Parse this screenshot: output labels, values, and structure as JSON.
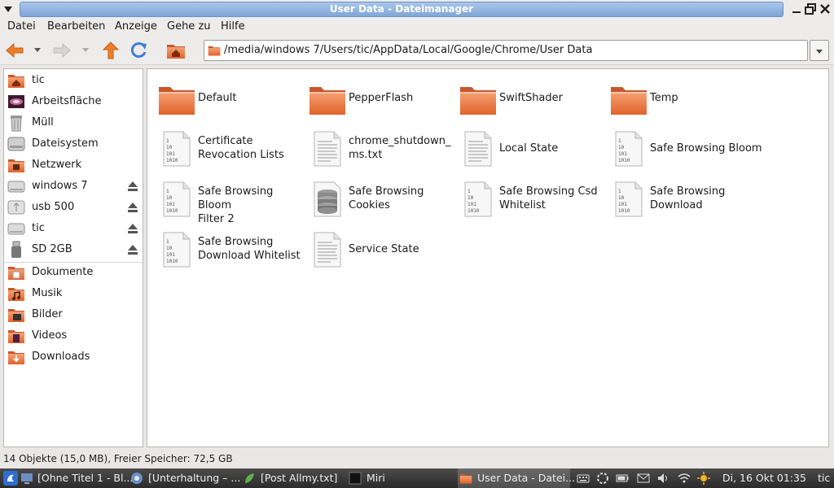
{
  "window": {
    "title": "User Data - Dateimanager"
  },
  "menu": [
    "Datei",
    "Bearbeiten",
    "Anzeige",
    "Gehe zu",
    "Hilfe"
  ],
  "address": {
    "path": "/media/windows 7/Users/tic/AppData/Local/Google/Chrome/User Data"
  },
  "sidebar": {
    "places": [
      {
        "label": "tic",
        "icon": "home-icon"
      },
      {
        "label": "Arbeitsfläche",
        "icon": "desktop-icon"
      },
      {
        "label": "Müll",
        "icon": "trash-icon"
      },
      {
        "label": "Dateisystem",
        "icon": "harddisk-icon"
      },
      {
        "label": "Netzwerk",
        "icon": "network-icon"
      }
    ],
    "devices": [
      {
        "label": "windows 7",
        "icon": "drive-icon"
      },
      {
        "label": "usb 500",
        "icon": "usb-drive-icon"
      },
      {
        "label": "tic",
        "icon": "drive-icon"
      },
      {
        "label": "SD 2GB",
        "icon": "usb-stick-icon"
      }
    ],
    "bookmarks": [
      {
        "label": "Dokumente",
        "icon": "documents-folder-icon"
      },
      {
        "label": "Musik",
        "icon": "music-folder-icon"
      },
      {
        "label": "Bilder",
        "icon": "pictures-folder-icon"
      },
      {
        "label": "Videos",
        "icon": "videos-folder-icon"
      },
      {
        "label": "Downloads",
        "icon": "downloads-folder-icon"
      }
    ]
  },
  "files": [
    {
      "line1": "Default",
      "line2": "",
      "type": "folder"
    },
    {
      "line1": "PepperFlash",
      "line2": "",
      "type": "folder"
    },
    {
      "line1": "SwiftShader",
      "line2": "",
      "type": "folder"
    },
    {
      "line1": "Temp",
      "line2": "",
      "type": "folder"
    },
    {
      "line1": "Certificate",
      "line2": "Revocation Lists",
      "type": "binary"
    },
    {
      "line1": "chrome_shutdown_",
      "line2": "ms.txt",
      "type": "text"
    },
    {
      "line1": "Local State",
      "line2": "",
      "type": "text"
    },
    {
      "line1": "Safe Browsing Bloom",
      "line2": "",
      "type": "binary"
    },
    {
      "line1": "Safe Browsing Bloom",
      "line2": "Filter 2",
      "type": "binary"
    },
    {
      "line1": "Safe Browsing",
      "line2": "Cookies",
      "type": "database"
    },
    {
      "line1": "Safe Browsing Csd",
      "line2": "Whitelist",
      "type": "binary"
    },
    {
      "line1": "Safe Browsing",
      "line2": "Download",
      "type": "binary"
    },
    {
      "line1": "Safe Browsing",
      "line2": "Download Whitelist",
      "type": "binary"
    },
    {
      "line1": "Service State",
      "line2": "",
      "type": "text"
    }
  ],
  "status": "14 Objekte (15,0 MB), Freier Speicher: 72,5 GB",
  "taskbar": {
    "tasks": [
      {
        "label": "[Ohne Titel 1 - Bl..."
      },
      {
        "label": "[Unterhaltung – ..."
      },
      {
        "label": "[Post Allmy.txt]"
      },
      {
        "label": "Miri"
      },
      {
        "label": "User Data - Datei..."
      }
    ],
    "clock": "Di, 16 Okt  01:35",
    "user": "tic"
  },
  "colors": {
    "folder": "#e9753a",
    "titlebar": "#8fb1de",
    "accent_orange": "#ee7d2b",
    "accent_blue": "#3d7fd6"
  }
}
